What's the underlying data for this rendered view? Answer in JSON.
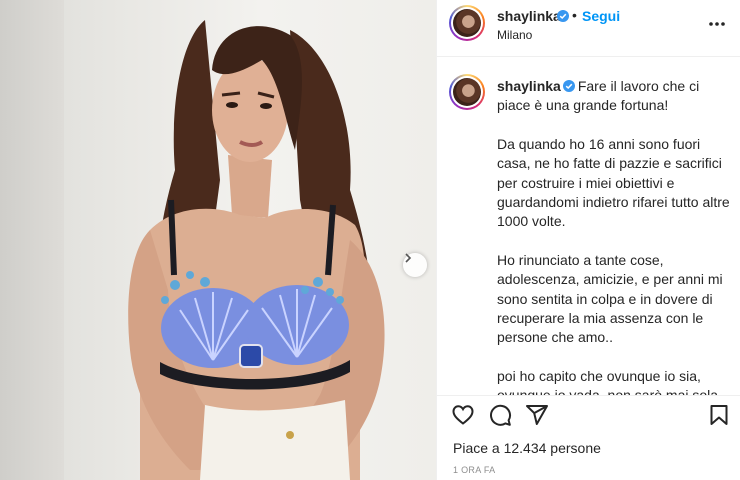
{
  "post": {
    "username": "shaylinka",
    "follow_label": "Segui",
    "separator": "•",
    "location": "Milano",
    "verified": true
  },
  "caption": {
    "username": "shaylinka",
    "line1": "Fare il lavoro che ci piace è una grande fortuna!",
    "para2": "Da quando ho 16 anni sono fuori casa, ne ho fatte di pazzie e sacrifici per costruire i miei obiettivi e guardandomi indietro rifarei tutto altre 1000 volte.",
    "para3": "Ho rinunciato a tante cose, adolescenza, amicizie, e per anni mi sono sentita in colpa e in dovere di recuperare la mia assenza con le persone che amo..",
    "para4": "poi ho capito che ovunque io sia, ovunque io vada, non sarò mai sola perché saremo sempre legati dal nostro cuore e dal profondo amore che ci unisce",
    "emoji": "❤️"
  },
  "engagement": {
    "likes_text": "Piace a 12.434 persone",
    "time_text": "1 ORA FA"
  },
  "icons": {
    "like": "heart-outline-icon",
    "comment": "comment-bubble-icon",
    "share": "paper-plane-icon",
    "save": "bookmark-icon",
    "more": "more-dots-icon",
    "next": "chevron-right-icon",
    "verified": "verified-badge-icon"
  },
  "colors": {
    "accent": "#0095f6",
    "verified": "#3897f0",
    "heart": "#ed4956",
    "muted": "#8e8e8e"
  }
}
